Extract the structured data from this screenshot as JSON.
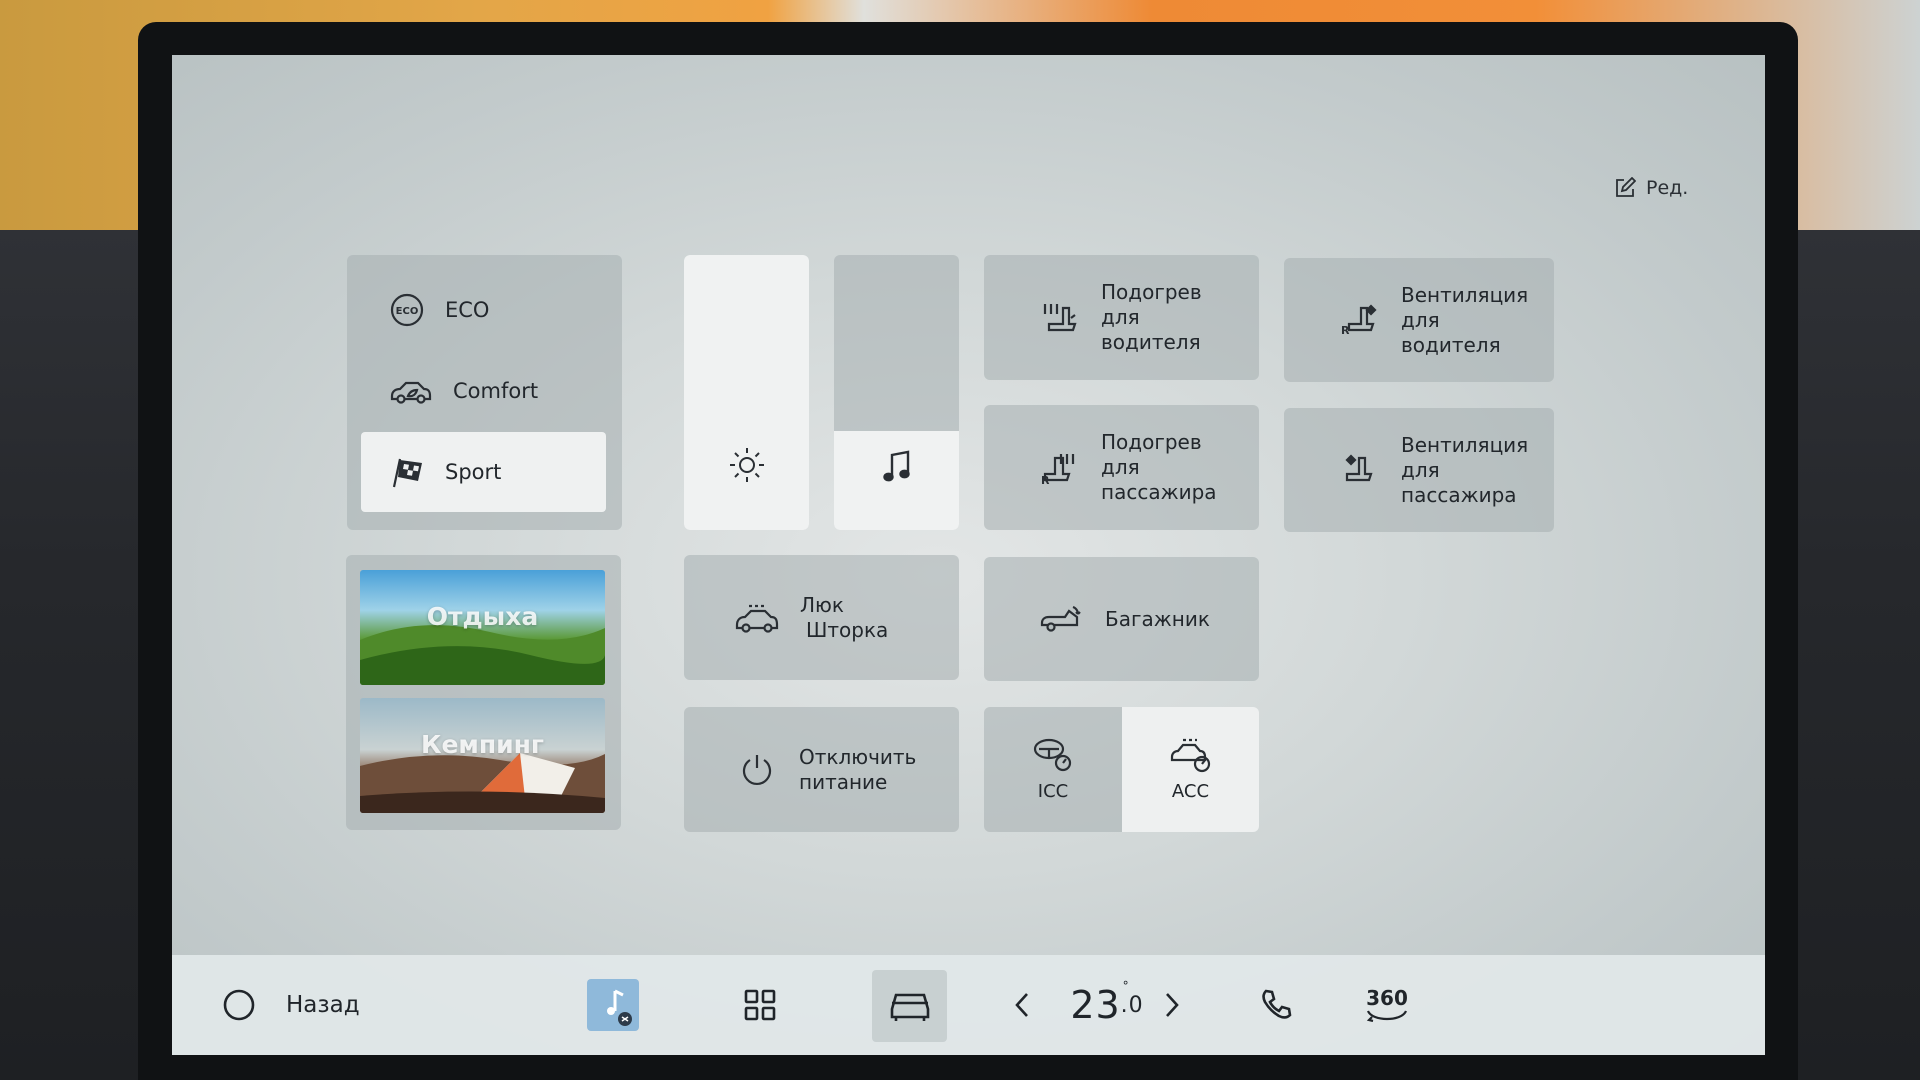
{
  "edit": {
    "label": "Ред."
  },
  "drive_modes": [
    {
      "label": "ECO",
      "icon": "eco-icon",
      "active": false
    },
    {
      "label": "Comfort",
      "icon": "car-leaf-icon",
      "active": false
    },
    {
      "label": "Sport",
      "icon": "checkered-flag-icon",
      "active": true
    }
  ],
  "sliders": {
    "brightness": {
      "icon": "sun-icon",
      "level": 1.0
    },
    "volume": {
      "icon": "music-note-icon",
      "level": 0.36
    }
  },
  "scenes": [
    {
      "label": "Отдыха",
      "image": "green-hills"
    },
    {
      "label": "Кемпинг",
      "image": "tent-dunes"
    }
  ],
  "tiles": {
    "heat_driver": {
      "label": "Подогрев для водителя",
      "line1": "Подогрев",
      "line2": "для",
      "line3": "водителя",
      "icon": "seat-heat-driver-icon"
    },
    "vent_driver": {
      "label": "Вентиляция для водителя",
      "line1": "Вентиляция",
      "line2": "для",
      "line3": "водителя",
      "icon": "seat-vent-driver-icon"
    },
    "heat_passenger": {
      "line1": "Подогрев",
      "line2": "для",
      "line3": "пассажира",
      "icon": "seat-heat-passenger-icon"
    },
    "vent_passenger": {
      "line1": "Вентиляция",
      "line2": "для",
      "line3": "пассажира",
      "icon": "seat-vent-passenger-icon"
    },
    "sunroof": {
      "line1": "Люк",
      "line2": "Шторка",
      "icon": "sunroof-icon"
    },
    "trunk": {
      "line1": "Багажник",
      "icon": "trunk-icon"
    },
    "power_off": {
      "line1": "Отключить",
      "line2": "питание",
      "icon": "power-icon"
    },
    "icc": {
      "label": "ICC",
      "icon": "icc-icon",
      "active": false
    },
    "acc": {
      "label": "ACC",
      "icon": "acc-icon",
      "active": true
    }
  },
  "bottom_bar": {
    "back_label": "Назад",
    "temperature_int": "23",
    "temperature_dec": ".0",
    "temperature_unit": "°",
    "cam_label": "360"
  },
  "colors": {
    "screen_bg": "#d2d8d8",
    "tile_bg": "#a5afb0",
    "active_bg": "#eff1f1",
    "text": "#22272c"
  }
}
